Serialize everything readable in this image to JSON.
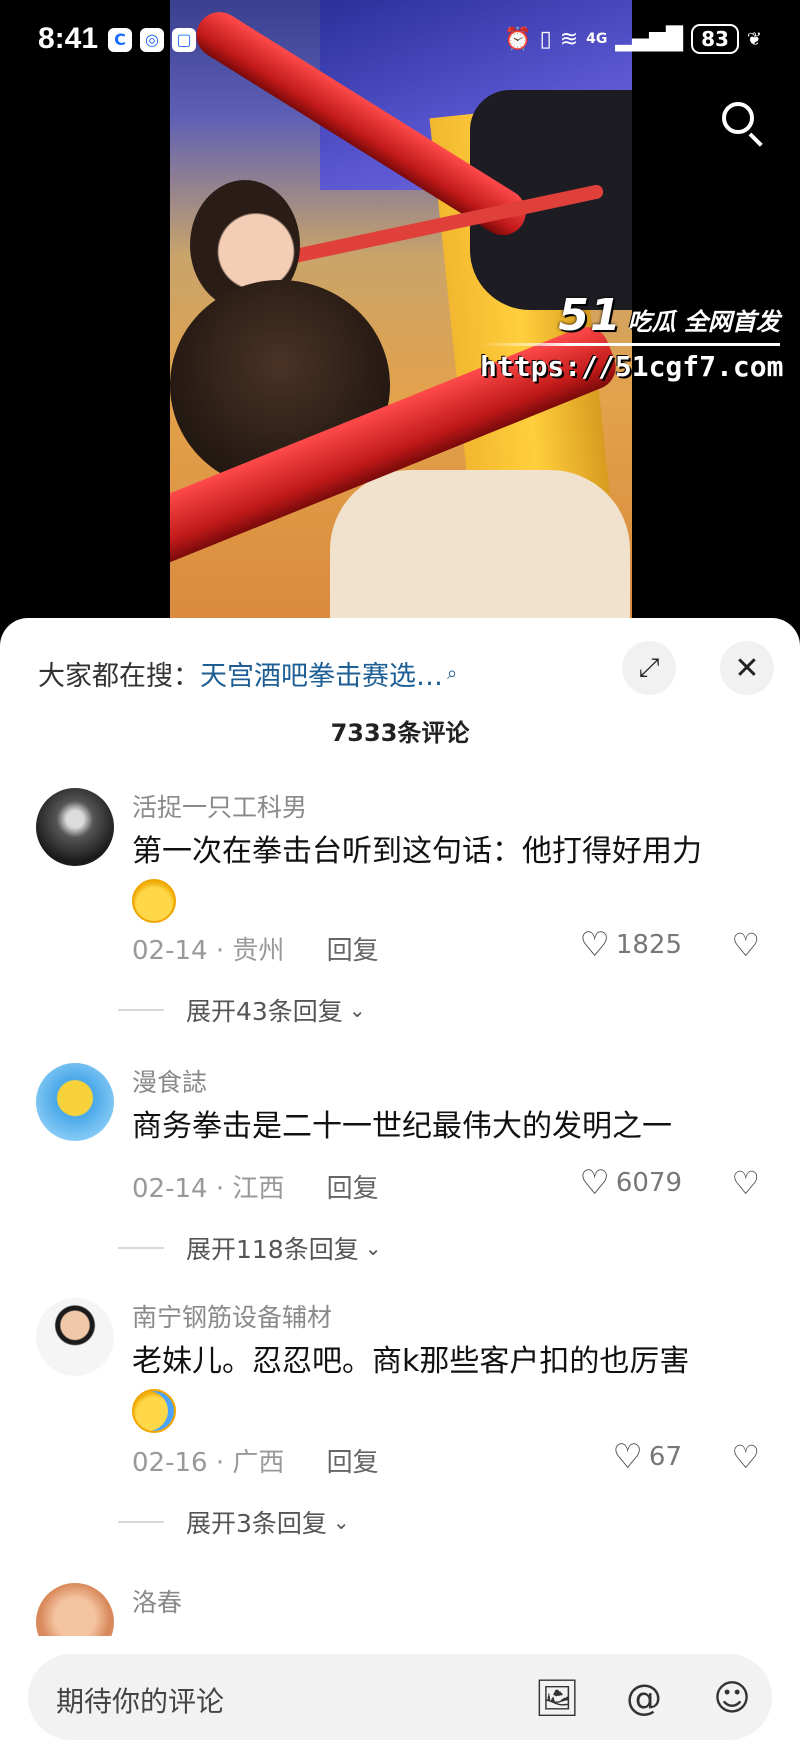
{
  "status_bar": {
    "time": "8:41",
    "app_icons": [
      "C",
      "◎",
      "▢"
    ],
    "signal_text": "4G",
    "battery": "83"
  },
  "video": {
    "watermark_logo": "51",
    "watermark_tag": "吃瓜 全网首发",
    "watermark_url": "https://51cgf7.com"
  },
  "sheet": {
    "search_label": "大家都在搜：",
    "search_link": "天宫酒吧拳击赛选…",
    "search_link_icon": "search-dot-icon",
    "expand_icon": "⤢",
    "close_icon": "✕",
    "comment_count_title": "7333条评论"
  },
  "comments": [
    {
      "username": "活捉一只工科男",
      "text": "第一次在拳击台听到这句话：他打得好用力",
      "emoji": "happy-emoji",
      "date": "02-14",
      "location": "贵州",
      "reply_label": "回复",
      "likes": "1825",
      "expand_replies": "展开43条回复"
    },
    {
      "username": "漫食誌",
      "text": "商务拳击是二十一世纪最伟大的发明之一",
      "emoji": "",
      "date": "02-14",
      "location": "江西",
      "reply_label": "回复",
      "likes": "6079",
      "expand_replies": "展开118条回复"
    },
    {
      "username": "南宁钢筋设备辅材",
      "text": "老妹儿。忍忍吧。商k那些客户扣的也厉害",
      "emoji": "crying-emoji",
      "date": "02-16",
      "location": "广西",
      "reply_label": "回复",
      "likes": "67",
      "expand_replies": "展开3条回复"
    },
    {
      "username": "洛春"
    }
  ],
  "bottom_bar": {
    "input_placeholder": "期待你的评论",
    "icons": [
      "image-icon",
      "at-icon",
      "emoji-icon"
    ]
  }
}
